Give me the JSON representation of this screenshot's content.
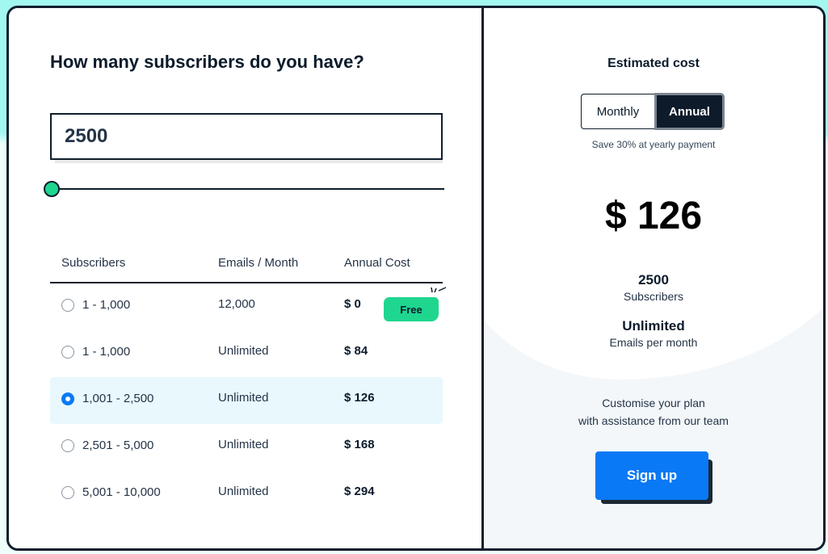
{
  "calculator": {
    "question": "How many subscribers do you have?",
    "subscriber_input_value": "2500",
    "slider_fraction": 0.0
  },
  "table": {
    "headers": {
      "subscribers": "Subscribers",
      "emails": "Emails / Month",
      "cost": "Annual Cost"
    },
    "rows": [
      {
        "subscribers": "1 - 1,000",
        "emails": "12,000",
        "cost": "$ 0",
        "badge": "Free",
        "selected": false
      },
      {
        "subscribers": "1 - 1,000",
        "emails": "Unlimited",
        "cost": "$ 84",
        "selected": false
      },
      {
        "subscribers": "1,001 - 2,500",
        "emails": "Unlimited",
        "cost": "$ 126",
        "selected": true
      },
      {
        "subscribers": "2,501 - 5,000",
        "emails": "Unlimited",
        "cost": "$ 168",
        "selected": false
      },
      {
        "subscribers": "5,001 - 10,000",
        "emails": "Unlimited",
        "cost": "$ 294",
        "selected": false
      }
    ]
  },
  "estimate": {
    "title": "Estimated cost",
    "toggle": {
      "monthly": "Monthly",
      "annual": "Annual",
      "active": "annual"
    },
    "save_note": "Save 30% at yearly payment",
    "price": "$ 126",
    "subscribers_value": "2500",
    "subscribers_label": "Subscribers",
    "emails_value": "Unlimited",
    "emails_label": "Emails per month",
    "custom_line1": "Customise your plan",
    "custom_line2": "with assistance from our team",
    "signup_label": "Sign up"
  },
  "colors": {
    "accent_blue": "#0a79f5",
    "accent_green": "#1fd68f",
    "dark": "#0e1b2b",
    "selected_row": "#e8f8fd",
    "background_teal": "#a2f7f0"
  }
}
